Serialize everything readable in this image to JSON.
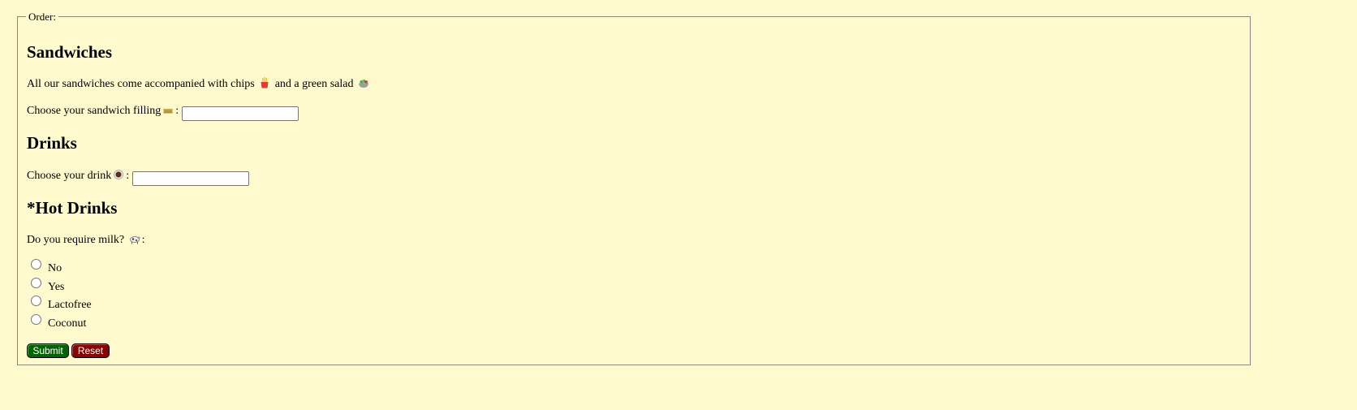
{
  "form": {
    "legend": "Order:",
    "sandwiches": {
      "heading": "Sandwiches",
      "description_prefix": "All our sandwiches come accompanied with chips",
      "description_middle": "and a green salad",
      "filling_label": "Choose your sandwich filling",
      "filling_suffix": ":",
      "filling_value": ""
    },
    "drinks": {
      "heading": "Drinks",
      "drink_label": "Choose your drink",
      "drink_suffix": ":",
      "drink_value": ""
    },
    "hot_drinks": {
      "heading": "*Hot Drinks",
      "milk_question": "Do you require milk?",
      "milk_suffix": ":",
      "options": [
        "No",
        "Yes",
        "Lactofree",
        "Coconut"
      ]
    },
    "buttons": {
      "submit": "Submit",
      "reset": "Reset"
    }
  },
  "colors": {
    "page_background": "#fffacd",
    "submit_background": "#006400",
    "reset_background": "#8b0000",
    "fieldset_border": "#888888"
  },
  "icons": {
    "chips": "fries-icon",
    "salad": "salad-icon",
    "sandwich": "sandwich-icon",
    "drink": "drink-icon",
    "milk": "cow-icon"
  }
}
